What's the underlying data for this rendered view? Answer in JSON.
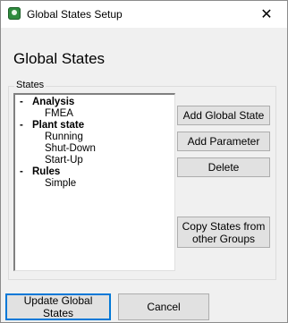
{
  "window": {
    "title": "Global States Setup",
    "close_symbol": "✕"
  },
  "heading": "Global States",
  "states_group": {
    "label": "States",
    "tree": [
      {
        "label": "Analysis",
        "expander": "-",
        "children": [
          "FMEA"
        ]
      },
      {
        "label": "Plant state",
        "expander": "-",
        "children": [
          "Running",
          "Shut-Down",
          "Start-Up"
        ]
      },
      {
        "label": "Rules",
        "expander": "-",
        "children": [
          "Simple"
        ]
      }
    ]
  },
  "buttons": {
    "add_global_state": "Add Global State",
    "add_parameter": "Add Parameter",
    "delete": "Delete",
    "copy_states": "Copy States from other Groups",
    "update": "Update Global States",
    "cancel": "Cancel"
  }
}
